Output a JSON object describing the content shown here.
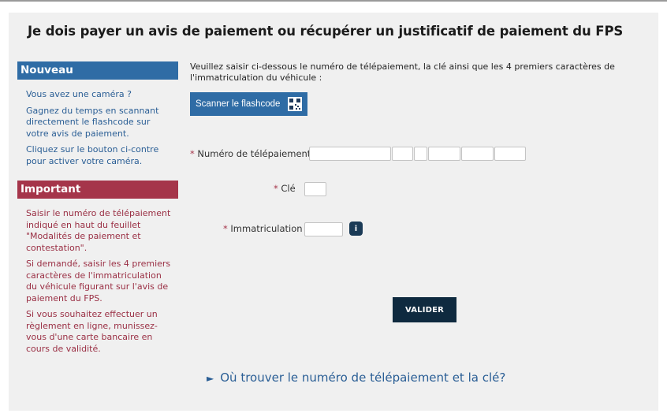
{
  "page": {
    "title": "Je dois payer un avis de paiement ou récupérer un justificatif de paiement du FPS"
  },
  "sidebar": {
    "nouveau": {
      "heading": "Nouveau",
      "paragraphs": [
        "Vous avez une caméra ?",
        "Gagnez du temps en scannant directement le flashcode sur votre avis de paiement.",
        "Cliquez sur le bouton ci-contre pour activer votre caméra."
      ]
    },
    "important": {
      "heading": "Important",
      "paragraphs": [
        "Saisir le numéro de télépaiement indiqué en haut du feuillet \"Modalités de paiement et contestation\".",
        "Si demandé, saisir les 4 premiers caractères de l'immatriculation du véhicule figurant sur l'avis de paiement du FPS.",
        "Si vous souhaitez effectuer un règlement en ligne, munissez-vous d'une carte bancaire en cours de validité."
      ]
    }
  },
  "form": {
    "instruction": "Veuillez saisir ci-dessous le numéro de télépaiement, la clé ainsi que les 4 premiers caractères de l'immatriculation du véhicule :",
    "scan_button_label": "Scanner le flashcode",
    "required_marker": "*",
    "numero_label": "Numéro de télépaiement",
    "cle_label": "Clé",
    "immat_label": "Immatriculation",
    "numero_values": [
      "",
      "",
      "",
      "",
      "",
      ""
    ],
    "cle_value": "",
    "immat_value": "",
    "info_button_label": "i",
    "submit_label": "VALIDER",
    "help_link": "Où trouver le numéro de télépaiement et la clé?"
  },
  "icons": {
    "scan": "qr-code-icon",
    "info": "info-icon",
    "help": "triangle-right-icon"
  },
  "colors": {
    "nouveau": "#2f6ca5",
    "important": "#a5354a",
    "submit": "#0f2a3f",
    "link": "#2a5e95"
  }
}
